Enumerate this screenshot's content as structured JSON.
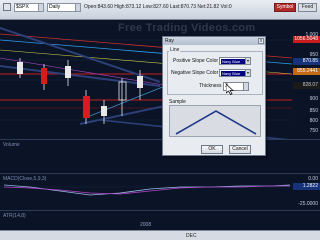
{
  "toolbar": {
    "symbol": "$SPX",
    "interval": "Daily",
    "quote": "Open:843.60 High:873.12 Low:827.60 Last:870.73 Net:21.82 Vol:0",
    "symbol_tab": "Symbol",
    "feed_tab": "Feed"
  },
  "watermark": "Free Trading Videos.com",
  "price_panel": {
    "scale_labels": [
      "1,000",
      "950",
      "900",
      "850",
      "800",
      "750"
    ],
    "badge_top": "1056.5048",
    "badge_mid": "870.85",
    "badge_mid2": "855.2441",
    "badge_low": "828.07",
    "colors": {
      "bull": "#e8e8e8",
      "bear": "#d71c1c",
      "upper_band": "#2d9cf0",
      "lower_band": "#d71c1c",
      "trendline": "#2c3f77"
    }
  },
  "volume_panel": {
    "label": "Volume"
  },
  "macd_panel": {
    "label": "MACD(Close,5,9,3)",
    "badge": "1.2822",
    "scale_labels": [
      "0.00",
      "-25.0000"
    ]
  },
  "atr_panel": {
    "label": "ATR(14,8)"
  },
  "date_axis": {
    "labels": [
      "DEC",
      "2008"
    ]
  },
  "dialog": {
    "title": "Ray",
    "close": "x",
    "group_line": "Line",
    "positive_label": "Positive Slope Color",
    "positive_value": "Navy Blue",
    "positive_color": "#000080",
    "negative_label": "Negative Slope Color",
    "negative_value": "Navy Blue",
    "negative_color": "#000080",
    "thickness_label": "Thickness",
    "thickness_value": "2",
    "group_sample": "Sample",
    "ok": "OK",
    "cancel": "Cancel"
  }
}
